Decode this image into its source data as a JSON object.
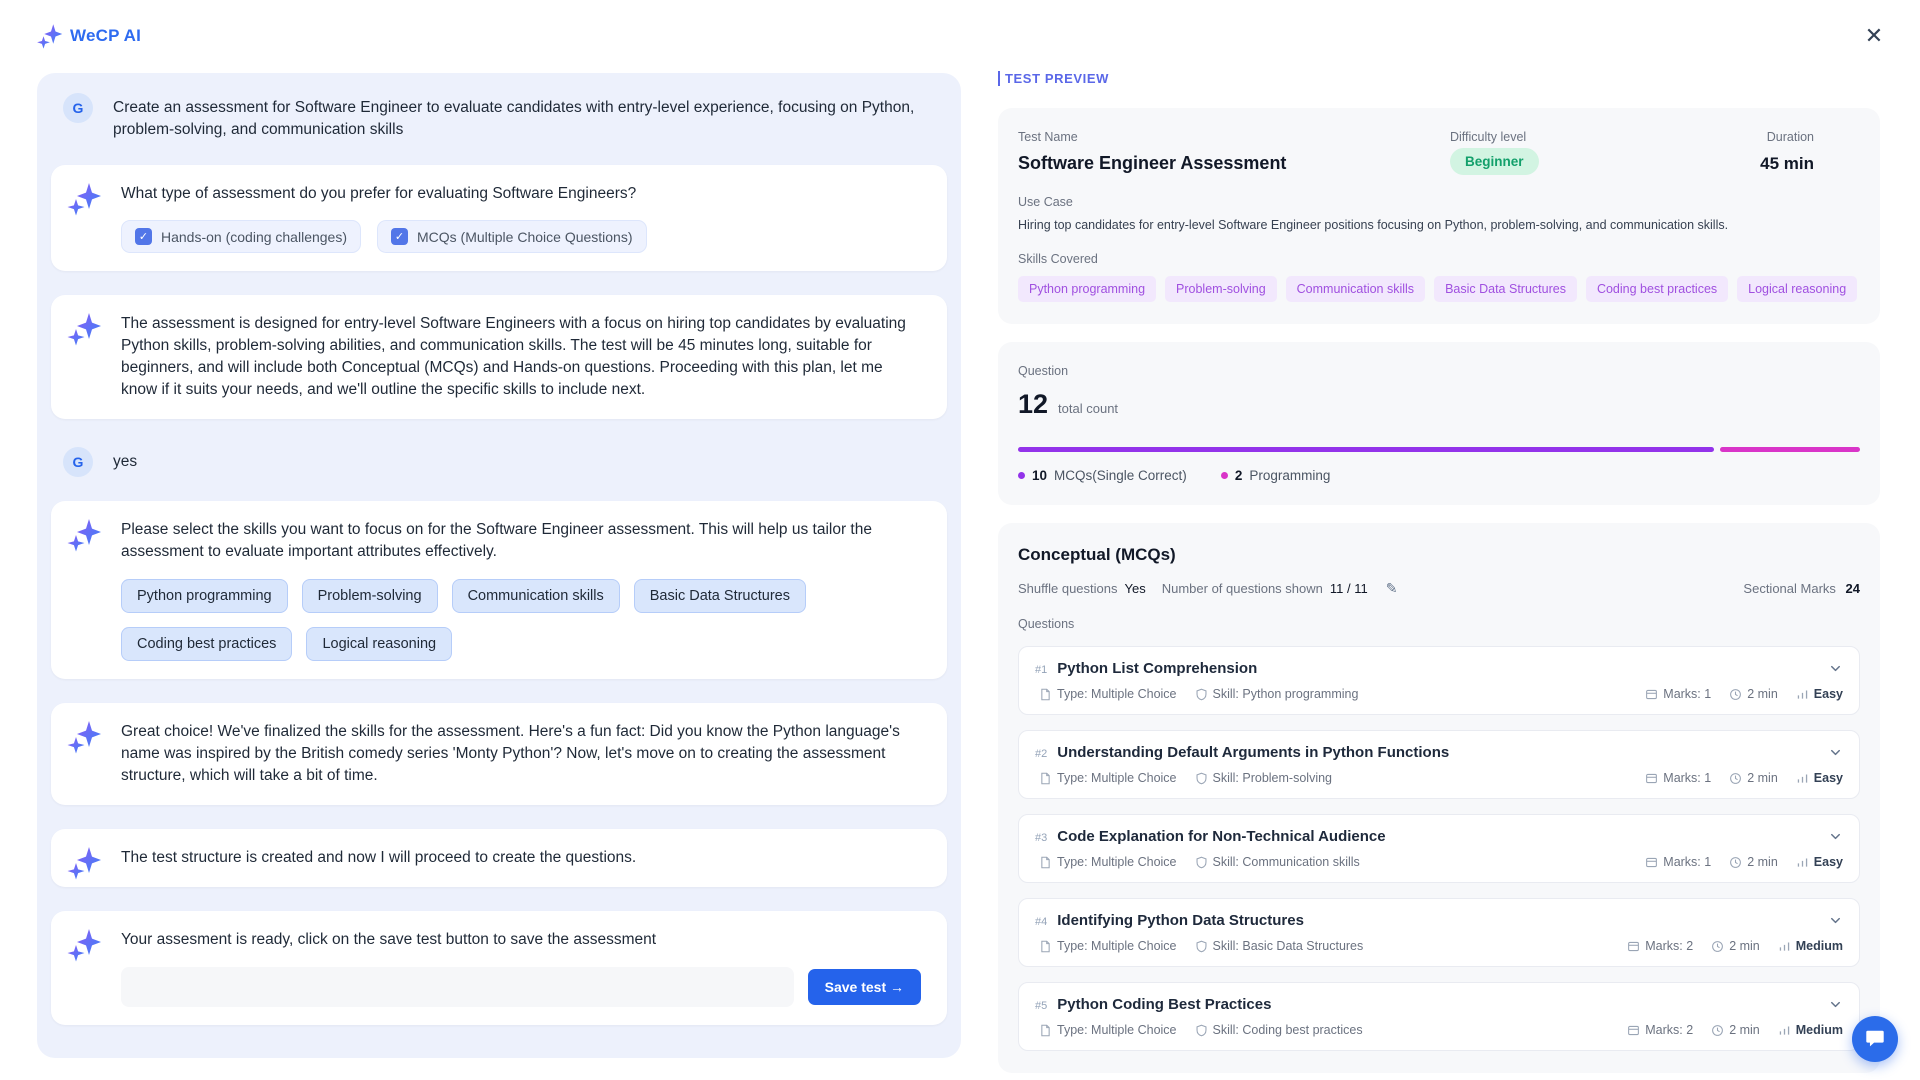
{
  "app": {
    "logo": "WeCP AI"
  },
  "icons": {
    "close": "✕",
    "check": "✓",
    "pencil": "✎"
  },
  "colors": {
    "accent_blue": "#2563eb",
    "mcq_purple": "#9333ea",
    "programming_pink": "#d935c8",
    "beginner_green": "#13a06b"
  },
  "chat": {
    "avatar": "G",
    "user1": "Create an assessment for Software Engineer to evaluate candidates with entry-level experience, focusing on Python, problem-solving, and communication skills",
    "ai1": {
      "text": "What type of assessment do you prefer for evaluating Software Engineers?",
      "options": [
        "Hands-on (coding challenges)",
        "MCQs (Multiple Choice Questions)"
      ]
    },
    "ai2": "The assessment is designed for entry-level Software Engineers with a focus on hiring top candidates by evaluating Python skills, problem-solving abilities, and communication skills. The test will be 45 minutes long, suitable for beginners, and will include both Conceptual (MCQs) and Hands-on questions. Proceeding with this plan, let me know if it suits your needs, and we'll outline the specific skills to include next.",
    "user2": "yes",
    "ai3": {
      "text": "Please select the skills you want to focus on for the Software Engineer assessment. This will help us tailor the assessment to evaluate important attributes effectively.",
      "skills": [
        "Python programming",
        "Problem-solving",
        "Communication skills",
        "Basic Data Structures",
        "Coding best practices",
        "Logical reasoning"
      ]
    },
    "ai4": "Great choice! We've finalized the skills for the assessment. Here's a fun fact: Did you know the Python language's name was inspired by the British comedy series 'Monty Python'? Now, let's move on to creating the assessment structure, which will take a bit of time.",
    "ai5": "The test structure is created and now I will proceed to create the questions.",
    "ai6": "Your assesment is ready, click on the save test button to save the assessment",
    "save_button": "Save test →"
  },
  "preview": {
    "header": "TEST PREVIEW",
    "test": {
      "name_label": "Test Name",
      "name": "Software Engineer Assessment",
      "difficulty_label": "Difficulty level",
      "difficulty": "Beginner",
      "duration_label": "Duration",
      "duration": "45 min",
      "use_case_label": "Use Case",
      "use_case": "Hiring top candidates for entry-level Software Engineer positions focusing on Python, problem-solving, and communication skills.",
      "skills_label": "Skills Covered",
      "skills": [
        "Python programming",
        "Problem-solving",
        "Communication skills",
        "Basic Data Structures",
        "Coding best practices",
        "Logical reasoning"
      ]
    },
    "summary": {
      "label": "Question",
      "total": "12",
      "total_caption": "total count",
      "legend": [
        {
          "count": "10",
          "label": "MCQs(Single Correct)",
          "color": "#9333ea",
          "width": "83.3%"
        },
        {
          "count": "2",
          "label": "Programming",
          "color": "#d935c8",
          "width": "16.7%"
        }
      ]
    },
    "section": {
      "title": "Conceptual (MCQs)",
      "shuffle_label": "Shuffle questions",
      "shuffle_value": "Yes",
      "shown_label": "Number of questions shown",
      "shown_value": "11 / 11",
      "sectional_marks_label": "Sectional Marks",
      "sectional_marks": "24",
      "questions_label": "Questions",
      "questions": [
        {
          "num": "#1",
          "title": "Python List Comprehension",
          "type": "Type: Multiple Choice",
          "skill": "Skill: Python programming",
          "marks": "Marks: 1",
          "time": "2 min",
          "difficulty": "Easy"
        },
        {
          "num": "#2",
          "title": "Understanding Default Arguments in Python Functions",
          "type": "Type: Multiple Choice",
          "skill": "Skill: Problem-solving",
          "marks": "Marks: 1",
          "time": "2 min",
          "difficulty": "Easy"
        },
        {
          "num": "#3",
          "title": "Code Explanation for Non-Technical Audience",
          "type": "Type: Multiple Choice",
          "skill": "Skill: Communication skills",
          "marks": "Marks: 1",
          "time": "2 min",
          "difficulty": "Easy"
        },
        {
          "num": "#4",
          "title": "Identifying Python Data Structures",
          "type": "Type: Multiple Choice",
          "skill": "Skill: Basic Data Structures",
          "marks": "Marks: 2",
          "time": "2 min",
          "difficulty": "Medium"
        },
        {
          "num": "#5",
          "title": "Python Coding Best Practices",
          "type": "Type: Multiple Choice",
          "skill": "Skill: Coding best practices",
          "marks": "Marks: 2",
          "time": "2 min",
          "difficulty": "Medium"
        }
      ]
    }
  }
}
